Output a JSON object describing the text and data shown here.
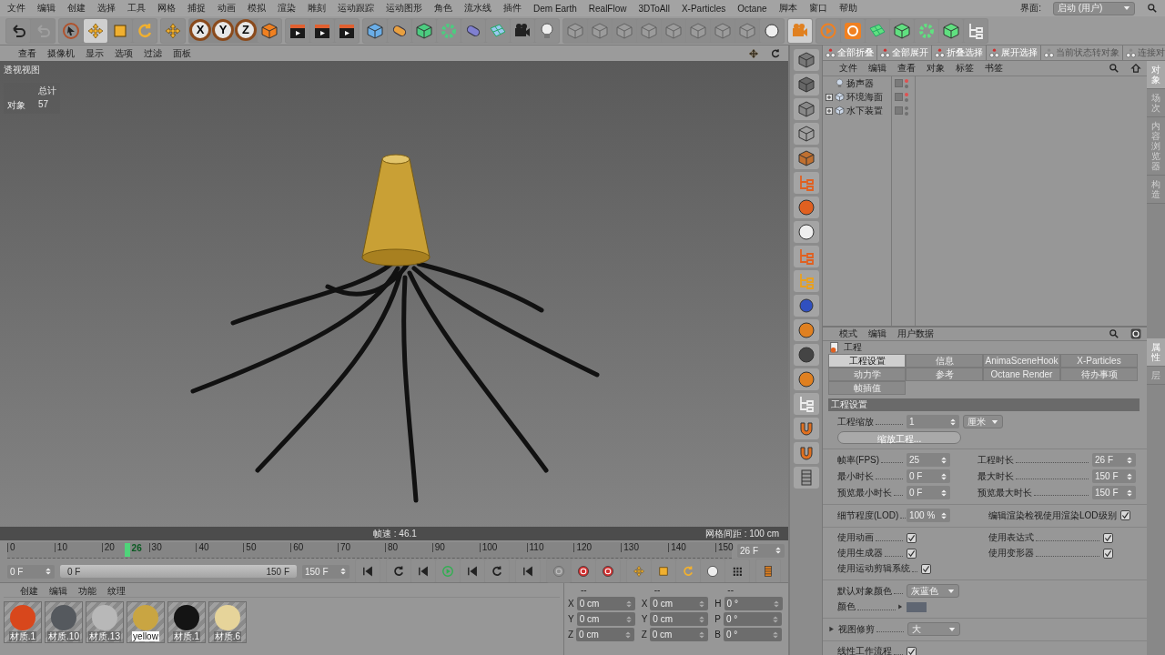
{
  "menu": [
    "文件",
    "编辑",
    "创建",
    "选择",
    "工具",
    "网格",
    "捕捉",
    "动画",
    "模拟",
    "渲染",
    "雕刻",
    "运动跟踪",
    "运动图形",
    "角色",
    "流水线",
    "插件",
    "Dem Earth",
    "RealFlow",
    "3DToAll",
    "X-Particles",
    "Octane",
    "脚本",
    "窗口",
    "帮助"
  ],
  "interface": {
    "label": "界面:",
    "value": "启动 (用户)"
  },
  "axis_buttons": [
    "X",
    "Y",
    "Z"
  ],
  "viewport": {
    "menu": [
      "查看",
      "摄像机",
      "显示",
      "选项",
      "过滤",
      "面板"
    ],
    "title": "透视视图",
    "hud_heading": "总计",
    "hud_rows": [
      {
        "label": "对象",
        "value": "57"
      }
    ],
    "status_left": "帧速 : 46.1",
    "status_right": "网格间距 : 100 cm"
  },
  "timeline": {
    "ticks": [
      "0",
      "10",
      "20",
      "30",
      "40",
      "50",
      "60",
      "70",
      "80",
      "90",
      "100",
      "110",
      "120",
      "130",
      "140",
      "150"
    ],
    "playhead": {
      "label": "26",
      "level": 0.173
    },
    "frame": "26 F"
  },
  "transport": {
    "start": "0 F",
    "range_start": "0 F",
    "range_end": "150 F",
    "level": 1,
    "end": "150 F"
  },
  "materials": {
    "menu": [
      "创建",
      "编辑",
      "功能",
      "纹理"
    ],
    "items": [
      {
        "name": "材质.1",
        "color": "#d8471c",
        "selected": false
      },
      {
        "name": "材质.10",
        "color": "#55595e",
        "selected": false
      },
      {
        "name": "材质.13",
        "color": "#b8b8b8",
        "selected": false
      },
      {
        "name": "yellow",
        "color": "#c9a542",
        "selected": true
      },
      {
        "name": "材质.1",
        "color": "#141414",
        "selected": false
      },
      {
        "name": "材质.6",
        "color": "#e6d49a",
        "selected": false
      }
    ]
  },
  "coordinates": {
    "headers": [
      "--",
      "--",
      "--"
    ],
    "rows": [
      [
        {
          "axis": "X",
          "value": "0 cm"
        },
        {
          "axis": "X",
          "value": "0 cm"
        },
        {
          "axis": "H",
          "value": "0 °"
        }
      ],
      [
        {
          "axis": "Y",
          "value": "0 cm"
        },
        {
          "axis": "Y",
          "value": "0 cm"
        },
        {
          "axis": "P",
          "value": "0 °"
        }
      ],
      [
        {
          "axis": "Z",
          "value": "0 cm"
        },
        {
          "axis": "Z",
          "value": "0 cm"
        },
        {
          "axis": "B",
          "value": "0 °"
        }
      ]
    ]
  },
  "object_manager": {
    "toolbar": [
      {
        "label": "全部折叠",
        "disabled": false
      },
      {
        "label": "全部展开",
        "disabled": false
      },
      {
        "label": "折叠选择",
        "disabled": false
      },
      {
        "label": "展开选择",
        "disabled": false
      },
      {
        "label": "当前状态转对象",
        "disabled": true
      },
      {
        "label": "连接对",
        "disabled": true
      }
    ],
    "menu": [
      "文件",
      "编辑",
      "查看",
      "对象",
      "标签",
      "书签"
    ],
    "objects": [
      {
        "name": "扬声器",
        "kind": "leaf",
        "visible": true
      },
      {
        "name": "环境海面",
        "kind": "group",
        "expanded": false,
        "visible": true
      },
      {
        "name": "水下装置",
        "kind": "group",
        "expanded": false,
        "visible": false
      }
    ]
  },
  "side_tabs_top": [
    {
      "label": "对象",
      "selected": true
    },
    {
      "label": "场次",
      "selected": false
    },
    {
      "label": "内容浏览器",
      "selected": false
    },
    {
      "label": "构造",
      "selected": false
    }
  ],
  "attributes": {
    "menu": [
      "模式",
      "编辑",
      "用户数据"
    ],
    "title": "工程",
    "tabs": [
      {
        "label": "工程设置",
        "selected": true
      },
      {
        "label": "信息",
        "selected": false
      },
      {
        "label": "AnimaSceneHook",
        "selected": false
      },
      {
        "label": "X-Particles",
        "selected": false
      },
      {
        "label": "动力学",
        "selected": false
      },
      {
        "label": "参考",
        "selected": false
      },
      {
        "label": "Octane Render",
        "selected": false
      },
      {
        "label": "待办事项",
        "selected": false
      },
      {
        "label": "帧插值",
        "selected": false
      }
    ],
    "section": "工程设置",
    "groups": [
      {
        "rows": [
          {
            "kind": "field_unit",
            "label": "工程缩放",
            "value": "1",
            "unit": "厘米"
          },
          {
            "kind": "button",
            "label": "缩放工程..."
          }
        ]
      },
      {
        "rows": [
          {
            "kind": "pair",
            "left": {
              "label": "帧率(FPS)",
              "value": "25"
            },
            "right": {
              "label": "工程时长",
              "value": "26 F"
            }
          },
          {
            "kind": "pair",
            "left": {
              "label": "最小时长",
              "value": "0 F"
            },
            "right": {
              "label": "最大时长",
              "value": "150 F"
            }
          },
          {
            "kind": "pair",
            "left": {
              "label": "预览最小时长",
              "value": "0 F"
            },
            "right": {
              "label": "预览最大时长",
              "value": "150 F"
            }
          }
        ]
      },
      {
        "rows": [
          {
            "kind": "field_check",
            "label": "细节程度(LOD)",
            "value": "100 %",
            "check_label": "编辑渲染检视使用渲染LOD级别",
            "checked": true
          }
        ]
      },
      {
        "rows": [
          {
            "kind": "check_pair",
            "left": {
              "label": "使用动画",
              "checked": true
            },
            "right": {
              "label": "使用表达式",
              "checked": true
            }
          },
          {
            "kind": "check_pair",
            "left": {
              "label": "使用生成器",
              "checked": true
            },
            "right": {
              "label": "使用变形器",
              "checked": true
            }
          },
          {
            "kind": "check",
            "label": "使用运动剪辑系统",
            "checked": true
          }
        ]
      },
      {
        "rows": [
          {
            "kind": "dropdown",
            "label": "默认对象颜色",
            "value": "灰蓝色"
          },
          {
            "kind": "color",
            "label": "颜色",
            "color": "#5f6672"
          }
        ]
      },
      {
        "rows": [
          {
            "kind": "group_dropdown",
            "label": "视图修剪",
            "value": "大"
          }
        ]
      },
      {
        "rows": [
          {
            "kind": "check",
            "label": "线性工作流程",
            "checked": true
          }
        ]
      }
    ]
  },
  "side_tabs_bottom": [
    {
      "label": "属性",
      "selected": true
    },
    {
      "label": "层",
      "selected": false
    }
  ]
}
